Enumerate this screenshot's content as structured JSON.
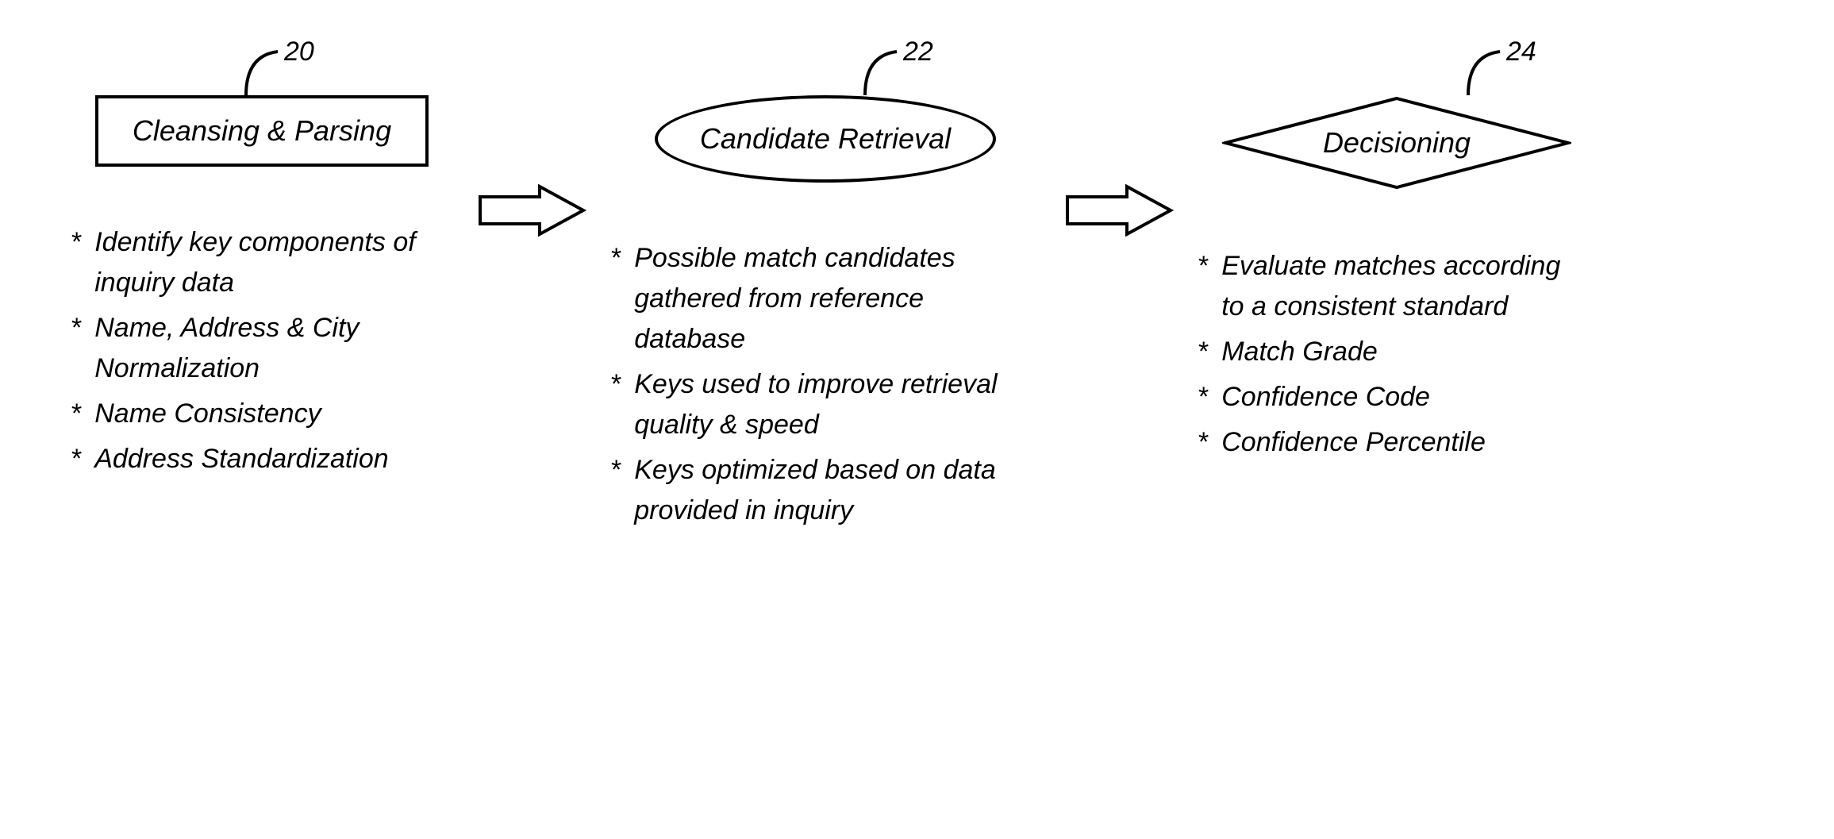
{
  "stage1": {
    "ref": "20",
    "title": "Cleansing & Parsing",
    "bullets": [
      "Identify key components of inquiry data",
      "Name, Address & City Normalization",
      "Name Consistency",
      "Address Standardization"
    ]
  },
  "stage2": {
    "ref": "22",
    "title": "Candidate Retrieval",
    "bullets": [
      "Possible match candidates gathered from reference database",
      "Keys used to improve retrieval quality & speed",
      "Keys optimized based on data provided in inquiry"
    ]
  },
  "stage3": {
    "ref": "24",
    "title": "Decisioning",
    "bullets": [
      "Evaluate matches according to a consistent standard",
      "Match Grade",
      "Confidence Code",
      "Confidence Percentile"
    ]
  }
}
